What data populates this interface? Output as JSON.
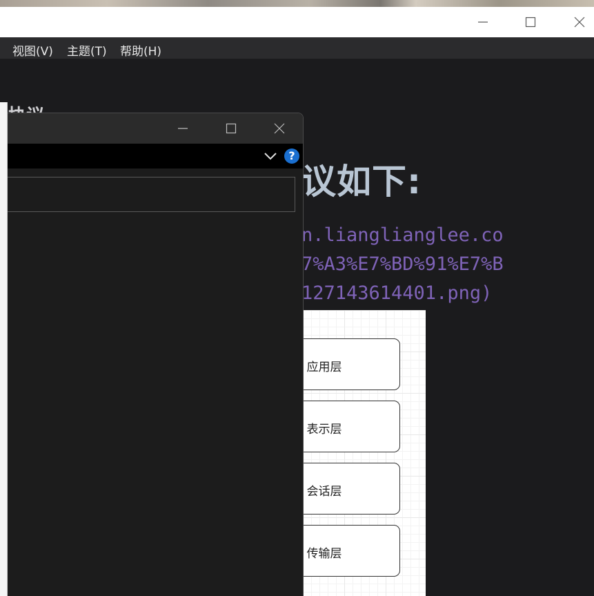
{
  "menubar": {
    "items": [
      {
        "label": "视图(V)"
      },
      {
        "label": "主题(T)"
      },
      {
        "label": "帮助(H)"
      }
    ]
  },
  "editor": {
    "partial_heading": "协议",
    "heading": "议如下:",
    "link_lines": [
      "n.lianglianglee.co",
      "7%A3%E7%BD%91%E7%B",
      "127143614401.png)"
    ]
  },
  "diagram": {
    "layers": [
      {
        "label": "应用层"
      },
      {
        "label": "表示层"
      },
      {
        "label": "会话层"
      },
      {
        "label": "传输层"
      }
    ]
  },
  "dialog": {
    "help_glyph": "?",
    "search_value": ""
  },
  "colors": {
    "heading": "#b9c6d4",
    "link": "#7f63b8",
    "help_accent": "#1a6fd0",
    "menubar_bg": "#2b2b2d",
    "editor_bg": "#1b1b1d"
  },
  "icons": {
    "minimize": "minimize-icon",
    "maximize": "maximize-icon",
    "close": "close-icon",
    "chevron": "chevron-down-icon",
    "help": "help-icon"
  }
}
